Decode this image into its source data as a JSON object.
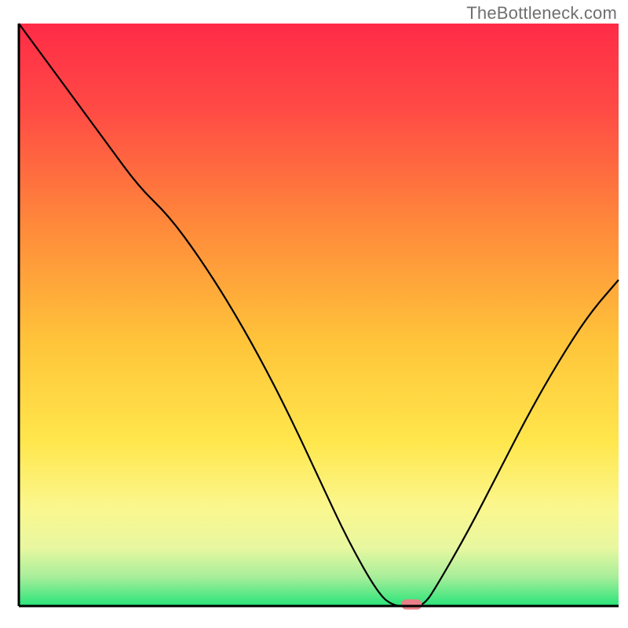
{
  "watermark": "TheBottleneck.com",
  "chart_data": {
    "type": "line",
    "title": "",
    "xlabel": "",
    "ylabel": "",
    "x": [
      0.0,
      0.05,
      0.1,
      0.15,
      0.2,
      0.25,
      0.3,
      0.35,
      0.4,
      0.45,
      0.5,
      0.55,
      0.6,
      0.625,
      0.65,
      0.675,
      0.7,
      0.75,
      0.8,
      0.85,
      0.9,
      0.95,
      1.0
    ],
    "values": [
      1.0,
      0.93,
      0.86,
      0.79,
      0.72,
      0.67,
      0.6,
      0.52,
      0.43,
      0.33,
      0.22,
      0.11,
      0.02,
      0.0,
      0.0,
      0.0,
      0.04,
      0.13,
      0.23,
      0.33,
      0.42,
      0.5,
      0.56
    ],
    "ylim": [
      0,
      1
    ],
    "xlim": [
      0,
      1
    ],
    "notes": "Bottleneck-style curve flat near zero around x≈0.63–0.68; vertical gradient background from red (top) through orange/yellow to green (bottom); small pink marker at curve minimum; no axis ticks or labels.",
    "marker": {
      "x": 0.655,
      "y": 0.0,
      "color": "#e97f87"
    },
    "colors": {
      "axis": "#000000",
      "curve": "#000000",
      "gradient_stops": [
        {
          "offset": 0.0,
          "color": "#ff2b47"
        },
        {
          "offset": 0.15,
          "color": "#ff4b45"
        },
        {
          "offset": 0.35,
          "color": "#ff8a3a"
        },
        {
          "offset": 0.55,
          "color": "#ffc53a"
        },
        {
          "offset": 0.72,
          "color": "#ffe74d"
        },
        {
          "offset": 0.83,
          "color": "#fbf78e"
        },
        {
          "offset": 0.9,
          "color": "#e8f7a0"
        },
        {
          "offset": 0.95,
          "color": "#a8ee9a"
        },
        {
          "offset": 1.0,
          "color": "#29e47a"
        }
      ]
    }
  }
}
